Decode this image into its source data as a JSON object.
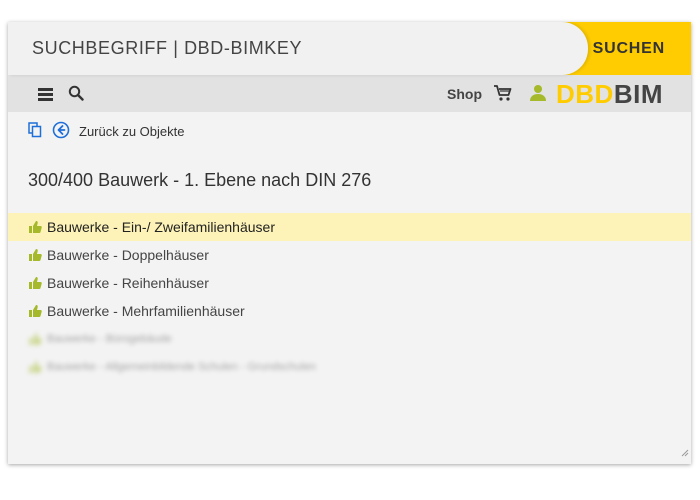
{
  "search": {
    "placeholder": "SUCHBEGRIFF | DBD-BIMKEY",
    "button_label": "SUCHEN"
  },
  "nav": {
    "menu_icon": "hamburger-icon",
    "search_icon": "magnifier-icon",
    "shop_label": "Shop",
    "cart_icon": "cart-icon",
    "user_icon": "user-icon",
    "logo_part1": "DBD",
    "logo_part2": "BIM"
  },
  "toolbar": {
    "copy_icon": "copy-icon",
    "back_icon": "arrow-left-circle-icon",
    "back_label": "Zurück zu Objekte"
  },
  "page": {
    "title": "300/400 Bauwerk - 1. Ebene nach DIN 276"
  },
  "list": {
    "items": [
      {
        "label": "Bauwerke - Ein-/ Zweifamilienhäuser",
        "highlighted": true
      },
      {
        "label": "Bauwerke - Doppelhäuser"
      },
      {
        "label": "Bauwerke - Reihenhäuser"
      },
      {
        "label": "Bauwerke - Mehrfamilienhäuser"
      },
      {
        "label": "Bauwerke - Bürogebäude",
        "blurred": true
      },
      {
        "label": "Bauwerke - Allgemeinbildende Schulen - Grundschulen",
        "blurred": true
      }
    ]
  },
  "colors": {
    "accent": "#fecc00",
    "highlight": "#fdf3b8",
    "thumb": "#a5b92a",
    "link_icon": "#1e6fd9"
  }
}
